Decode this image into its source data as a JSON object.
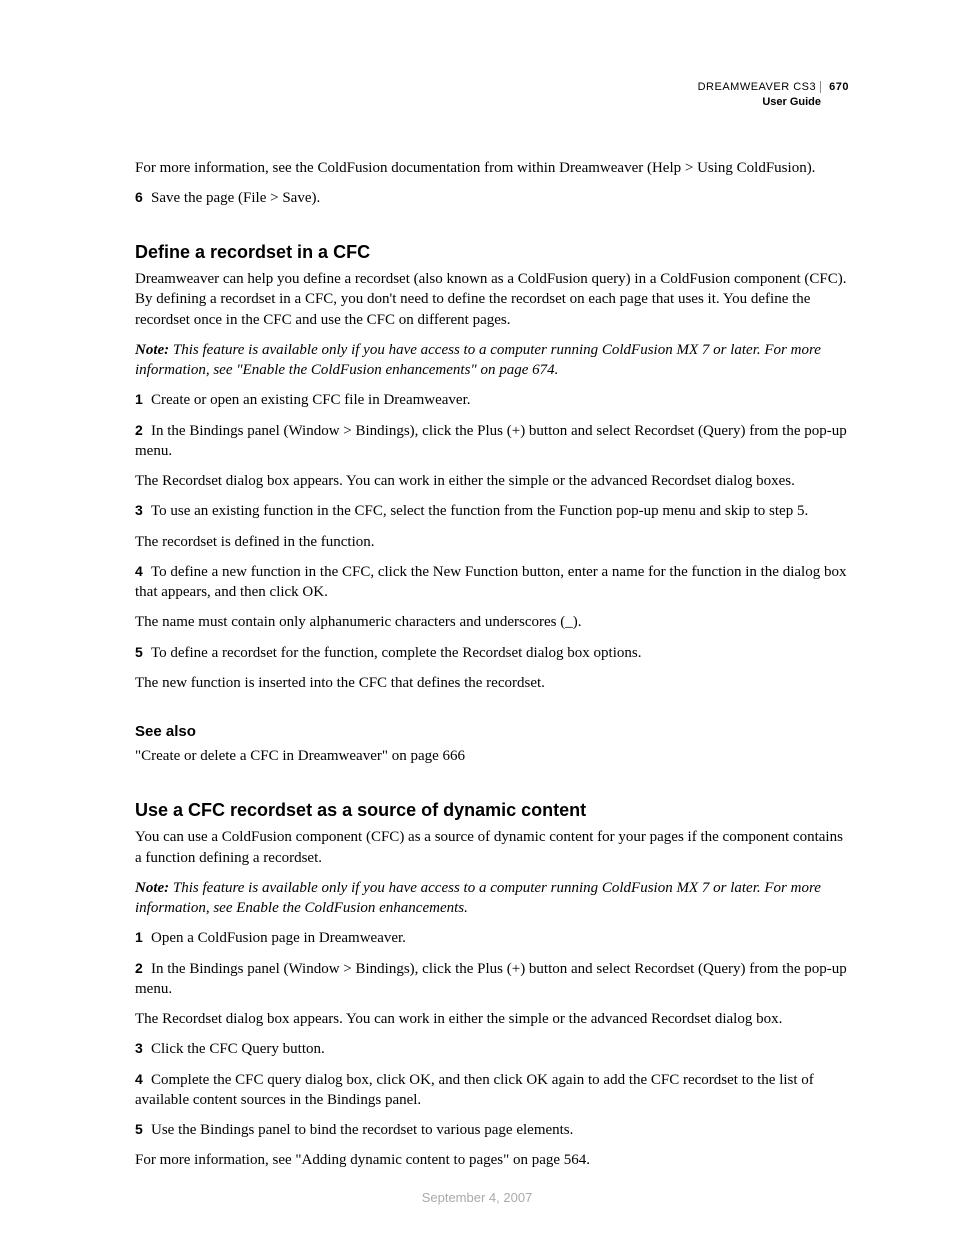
{
  "header": {
    "product": "DREAMWEAVER CS3",
    "page_number": "670",
    "subtitle": "User Guide"
  },
  "intro": {
    "p1": "For more information, see the ColdFusion documentation from within Dreamweaver (Help > Using ColdFusion).",
    "step6_num": "6",
    "step6_text": "Save the page (File > Save)."
  },
  "section1": {
    "heading": "Define a recordset in a CFC",
    "p1": "Dreamweaver can help you define a recordset (also known as a ColdFusion query) in a ColdFusion component (CFC). By defining a recordset in a CFC, you don't need to define the recordset on each page that uses it. You define the recordset once in the CFC and use the CFC on different pages.",
    "note_label": "Note:",
    "note_body": " This feature is available only if you have access to a computer running ColdFusion MX 7 or later. For more information, see \"Enable the ColdFusion enhancements\" on page 674.",
    "s1_num": "1",
    "s1_text": "Create or open an existing CFC file in Dreamweaver.",
    "s2_num": "2",
    "s2_text": "In the Bindings panel (Window > Bindings), click the Plus (+) button and select Recordset (Query) from the pop-up menu.",
    "p_after2": "The Recordset dialog box appears. You can work in either the simple or the advanced Recordset dialog boxes.",
    "s3_num": "3",
    "s3_text": "To use an existing function in the CFC, select the function from the Function pop-up menu and skip to step 5.",
    "p_after3": "The recordset is defined in the function.",
    "s4_num": "4",
    "s4_text": "To define a new function in the CFC, click the New Function button, enter a name for the function in the dialog box that appears, and then click OK.",
    "p_after4": "The name must contain only alphanumeric characters and underscores (_).",
    "s5_num": "5",
    "s5_text": "To define a recordset for the function, complete the Recordset dialog box options.",
    "p_after5": "The new function is inserted into the CFC that defines the recordset."
  },
  "seealso": {
    "heading": "See also",
    "link": "\"Create or delete a CFC in Dreamweaver\" on page 666"
  },
  "section2": {
    "heading": "Use a CFC recordset as a source of dynamic content",
    "p1": "You can use a ColdFusion component (CFC) as a source of dynamic content for your pages if the component contains a function defining a recordset.",
    "note_label": "Note:",
    "note_body": " This feature is available only if you have access to a computer running ColdFusion MX 7 or later. For more information, see Enable the ColdFusion enhancements.",
    "s1_num": "1",
    "s1_text": "Open a ColdFusion page in Dreamweaver.",
    "s2_num": "2",
    "s2_text": "In the Bindings panel (Window > Bindings), click the Plus (+) button and select Recordset (Query) from the pop-up menu.",
    "p_after2": "The Recordset dialog box appears. You can work in either the simple or the advanced Recordset dialog box.",
    "s3_num": "3",
    "s3_text": "Click the CFC Query button.",
    "s4_num": "4",
    "s4_text": "Complete the CFC query dialog box, click OK, and then click OK again to add the CFC recordset to the list of available content sources in the Bindings panel.",
    "s5_num": "5",
    "s5_text": "Use the Bindings panel to bind the recordset to various page elements.",
    "p_after5": "For more information, see \"Adding dynamic content to pages\" on page 564."
  },
  "footer": {
    "date": "September 4, 2007"
  }
}
